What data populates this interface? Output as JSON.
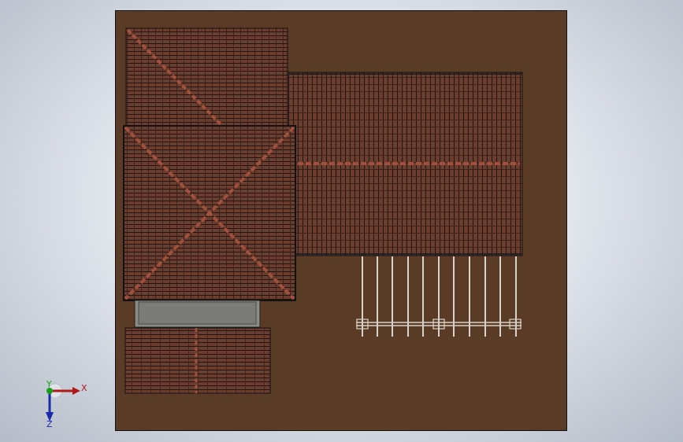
{
  "view": {
    "title": "",
    "background_color": "#cfd5de",
    "ground_color": "#5a3b26",
    "roof_tile_color": "#6b3d2f",
    "tile_line_color": "#1e1410",
    "ridge_color": "#a0503c",
    "canopy_color": "#7b7b78"
  },
  "triad": {
    "x_label": "X",
    "y_label": "Y",
    "z_label": "Z",
    "x_color": "#b01818",
    "y_color": "#18a018",
    "z_color": "#1a2aa8"
  }
}
